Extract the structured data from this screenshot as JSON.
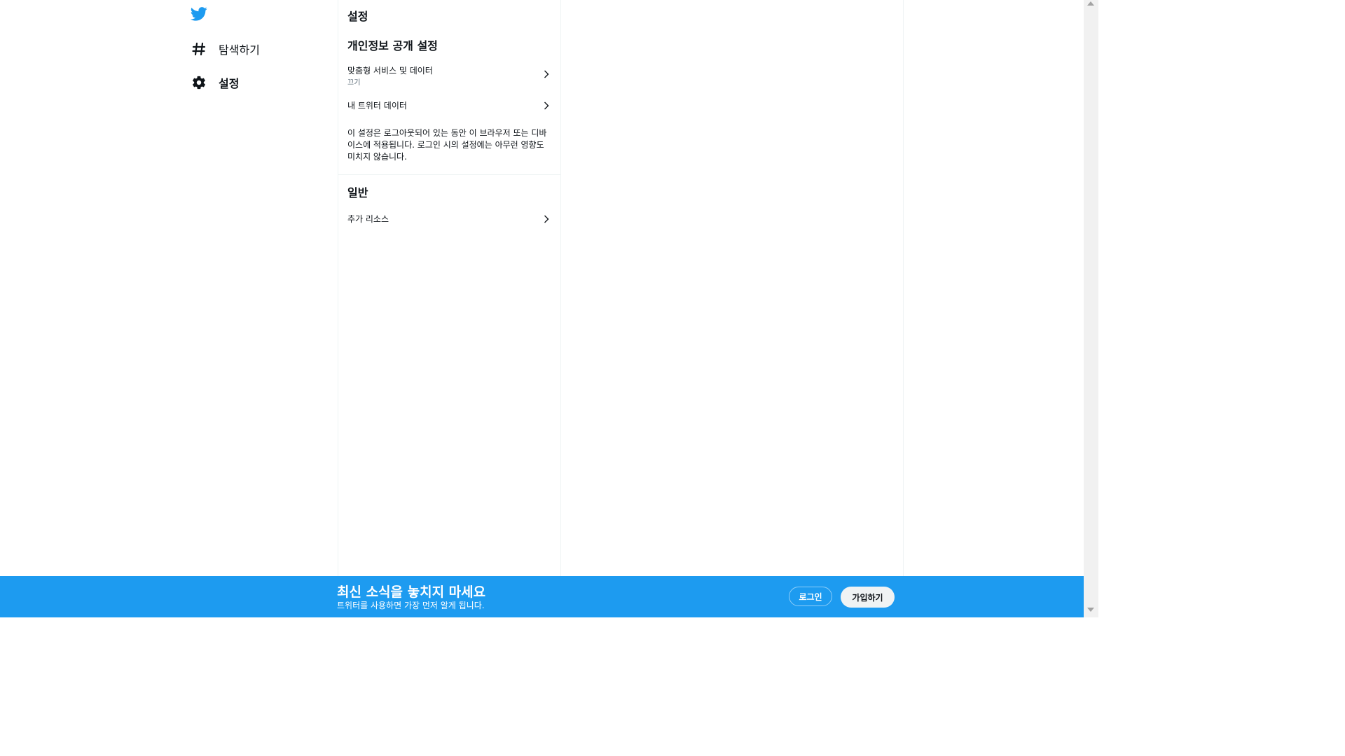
{
  "colors": {
    "brand": "#1d9bf0",
    "text": "#0f1419",
    "secondary_text": "#536471"
  },
  "nav": {
    "logo_icon": "twitter-bird-icon",
    "items": [
      {
        "label": "탐색하기",
        "icon": "hashtag-icon"
      },
      {
        "label": "설정",
        "icon": "gear-icon",
        "active": true
      }
    ]
  },
  "settings": {
    "title": "설정",
    "privacy": {
      "heading": "개인정보 공개 설정",
      "rows": [
        {
          "label": "맞춤형 서비스 및 데이터",
          "value": "끄기"
        },
        {
          "label": "내 트위터 데이터"
        }
      ],
      "description": "이 설정은 로그아웃되어 있는 동안 이 브라우저 또는 디바이스에 적용됩니다. 로그인 시의 설정에는 아무런 영향도 미치지 않습니다."
    },
    "general": {
      "heading": "일반",
      "rows": [
        {
          "label": "추가 리소스"
        }
      ]
    }
  },
  "bottom_bar": {
    "title": "최신 소식을 놓치지 마세요",
    "subtitle": "트위터를 사용하면 가장 먼저 알게 됩니다.",
    "login_label": "로그인",
    "signup_label": "가입하기"
  }
}
